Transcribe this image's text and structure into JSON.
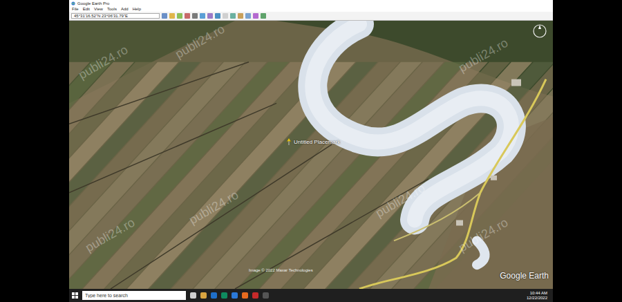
{
  "window": {
    "title": "Google Earth Pro"
  },
  "menu": [
    "File",
    "Edit",
    "View",
    "Tools",
    "Add",
    "Help"
  ],
  "toolbar": {
    "coordinates": "45°31'16.52\"N 23°06'31.79\"E"
  },
  "map": {
    "placemark": "Untitled Placemark",
    "attribution": "Image © 2022 Maxar Technologies",
    "logo": "Google Earth"
  },
  "watermarks": [
    "publi24.ro",
    "publi24.ro",
    "publi24.ro",
    "publi24.ro",
    "publi24.ro",
    "publi24.ro",
    "publi24.ro"
  ],
  "taskbar": {
    "search": {
      "placeholder": "Type here to search"
    },
    "time": "10:44 AM",
    "date": "12/22/2022"
  }
}
